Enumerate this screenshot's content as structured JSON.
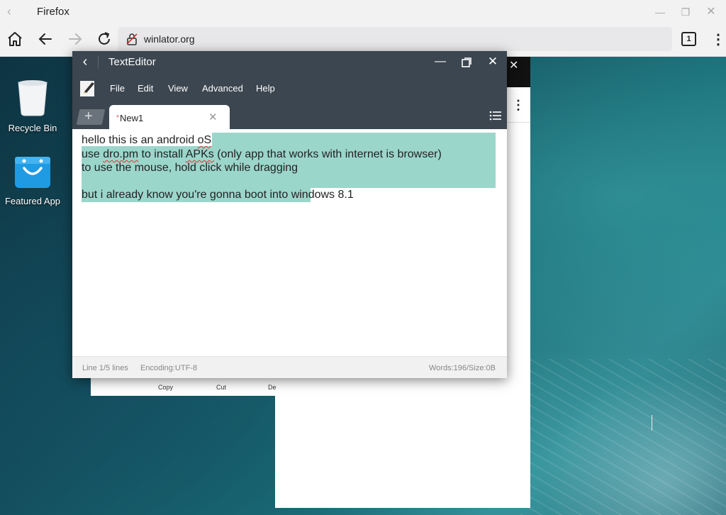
{
  "browser": {
    "title": "Firefox",
    "url": "winlator.org",
    "tab_count": "1",
    "icons": [
      "home-icon",
      "back-icon",
      "forward-icon",
      "reload-icon",
      "lock-icon",
      "tabs-icon",
      "menu-icon"
    ]
  },
  "desktop": {
    "icons": [
      {
        "label": "Recycle Bin",
        "icon": "recycle-bin-icon"
      },
      {
        "label": "Featured App",
        "icon": "shopping-bag-icon"
      }
    ]
  },
  "background_page": {
    "context_menu": [
      "Copy",
      "Cut",
      "De"
    ]
  },
  "editor": {
    "title": "TextEditor",
    "menu": [
      "File",
      "Edit",
      "View",
      "Advanced",
      "Help"
    ],
    "tab": {
      "label": "New1",
      "modified_marker": "*"
    },
    "lines": {
      "l1_a": "hello this is an android ",
      "l1_b": "oS",
      "l2_a": "use ",
      "l2_b": "dro.pm",
      "l2_c": " to install ",
      "l2_d": "APKs",
      "l2_e": " (only app that works with internet is browser)",
      "l3": "to use the mouse, hold click while dragging",
      "l4": "",
      "l5": "but i already know you're gonna boot into windows 8.1"
    },
    "status": {
      "line": "Line 1/5 lines",
      "encoding": "Encoding:UTF-8",
      "words": "Words:196/Size:0B"
    },
    "colors": {
      "chrome": "#3c4650",
      "selection": "#9bd6cb"
    }
  }
}
